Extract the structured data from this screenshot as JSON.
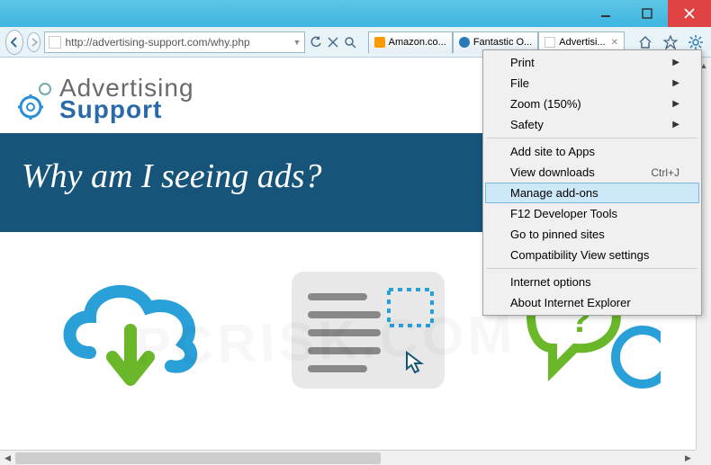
{
  "window": {
    "url": "http://advertising-support.com/why.php"
  },
  "tabs": [
    {
      "label": "Amazon.co..."
    },
    {
      "label": "Fantastic O..."
    },
    {
      "label": "Advertisi..."
    }
  ],
  "page": {
    "logo_line1": "Advertising",
    "logo_line2": "Support",
    "subhead": "Why am I seeing",
    "hero_title": "Why am I seeing ads?"
  },
  "menu": {
    "print": "Print",
    "file": "File",
    "zoom": "Zoom (150%)",
    "safety": "Safety",
    "add_site": "Add site to Apps",
    "view_downloads": "View downloads",
    "view_downloads_kbd": "Ctrl+J",
    "manage_addons": "Manage add-ons",
    "f12": "F12 Developer Tools",
    "pinned": "Go to pinned sites",
    "compat": "Compatibility View settings",
    "inet_opts": "Internet options",
    "about": "About Internet Explorer"
  }
}
